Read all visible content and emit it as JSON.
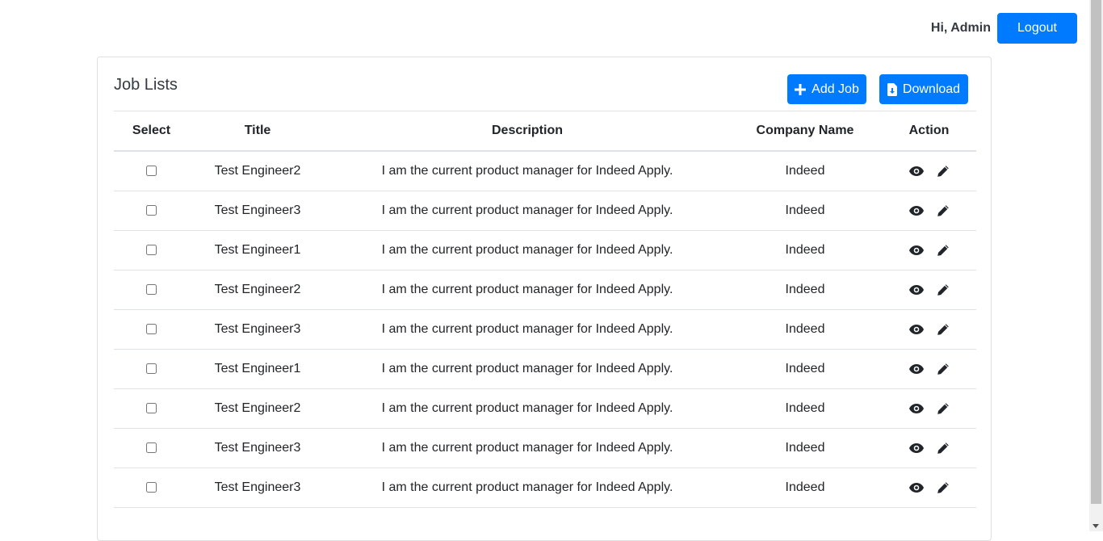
{
  "header": {
    "greeting": "Hi, Admin",
    "logout_label": "Logout"
  },
  "card": {
    "title": "Job Lists",
    "add_label": "Add Job",
    "download_label": "Download"
  },
  "table": {
    "columns": [
      "Select",
      "Title",
      "Description",
      "Company Name",
      "Action"
    ],
    "rows": [
      {
        "title": "Test Engineer2",
        "description": "I am the current product manager for Indeed Apply.",
        "company": "Indeed"
      },
      {
        "title": "Test Engineer3",
        "description": "I am the current product manager for Indeed Apply.",
        "company": "Indeed"
      },
      {
        "title": "Test Engineer1",
        "description": "I am the current product manager for Indeed Apply.",
        "company": "Indeed"
      },
      {
        "title": "Test Engineer2",
        "description": "I am the current product manager for Indeed Apply.",
        "company": "Indeed"
      },
      {
        "title": "Test Engineer3",
        "description": "I am the current product manager for Indeed Apply.",
        "company": "Indeed"
      },
      {
        "title": "Test Engineer1",
        "description": "I am the current product manager for Indeed Apply.",
        "company": "Indeed"
      },
      {
        "title": "Test Engineer2",
        "description": "I am the current product manager for Indeed Apply.",
        "company": "Indeed"
      },
      {
        "title": "Test Engineer3",
        "description": "I am the current product manager for Indeed Apply.",
        "company": "Indeed"
      },
      {
        "title": "Test Engineer3",
        "description": "I am the current product manager for Indeed Apply.",
        "company": "Indeed"
      }
    ]
  },
  "icons": {
    "view": "eye-icon",
    "edit": "pencil-icon",
    "add": "plus-icon",
    "download": "file-download-icon"
  },
  "colors": {
    "primary": "#007bff",
    "text": "#212529",
    "border": "#dee2e6"
  }
}
